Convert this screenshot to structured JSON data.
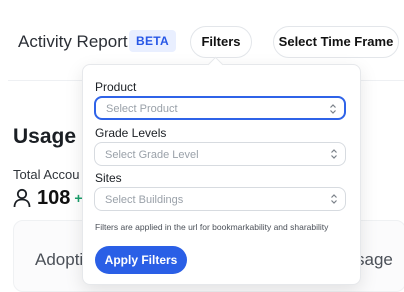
{
  "header": {
    "title": "Activity Report",
    "badge": "BETA",
    "filters_label": "Filters",
    "timeframe_label": "Select Time Frame"
  },
  "usage": {
    "title": "Usage S",
    "total_label": "Total Accou",
    "total_value": "108",
    "total_delta": "+",
    "icons": {
      "user": "person-outline-icon"
    }
  },
  "card": {
    "left_text": "Adopti",
    "right_text": "sage"
  },
  "filters_panel": {
    "product": {
      "label": "Product",
      "placeholder": "Select Product"
    },
    "grade_levels": {
      "label": "Grade Levels",
      "placeholder": "Select Grade Level"
    },
    "sites": {
      "label": "Sites",
      "placeholder": "Select Buildings"
    },
    "note": "Filters are applied in the url for bookmarkability and sharability",
    "apply_label": "Apply Filters",
    "icons": {
      "select": "chevron-up-down-icon"
    }
  },
  "colors": {
    "accent": "#2a5fe6",
    "badge_bg": "#e9efff",
    "delta_green": "#1a9f6b"
  }
}
